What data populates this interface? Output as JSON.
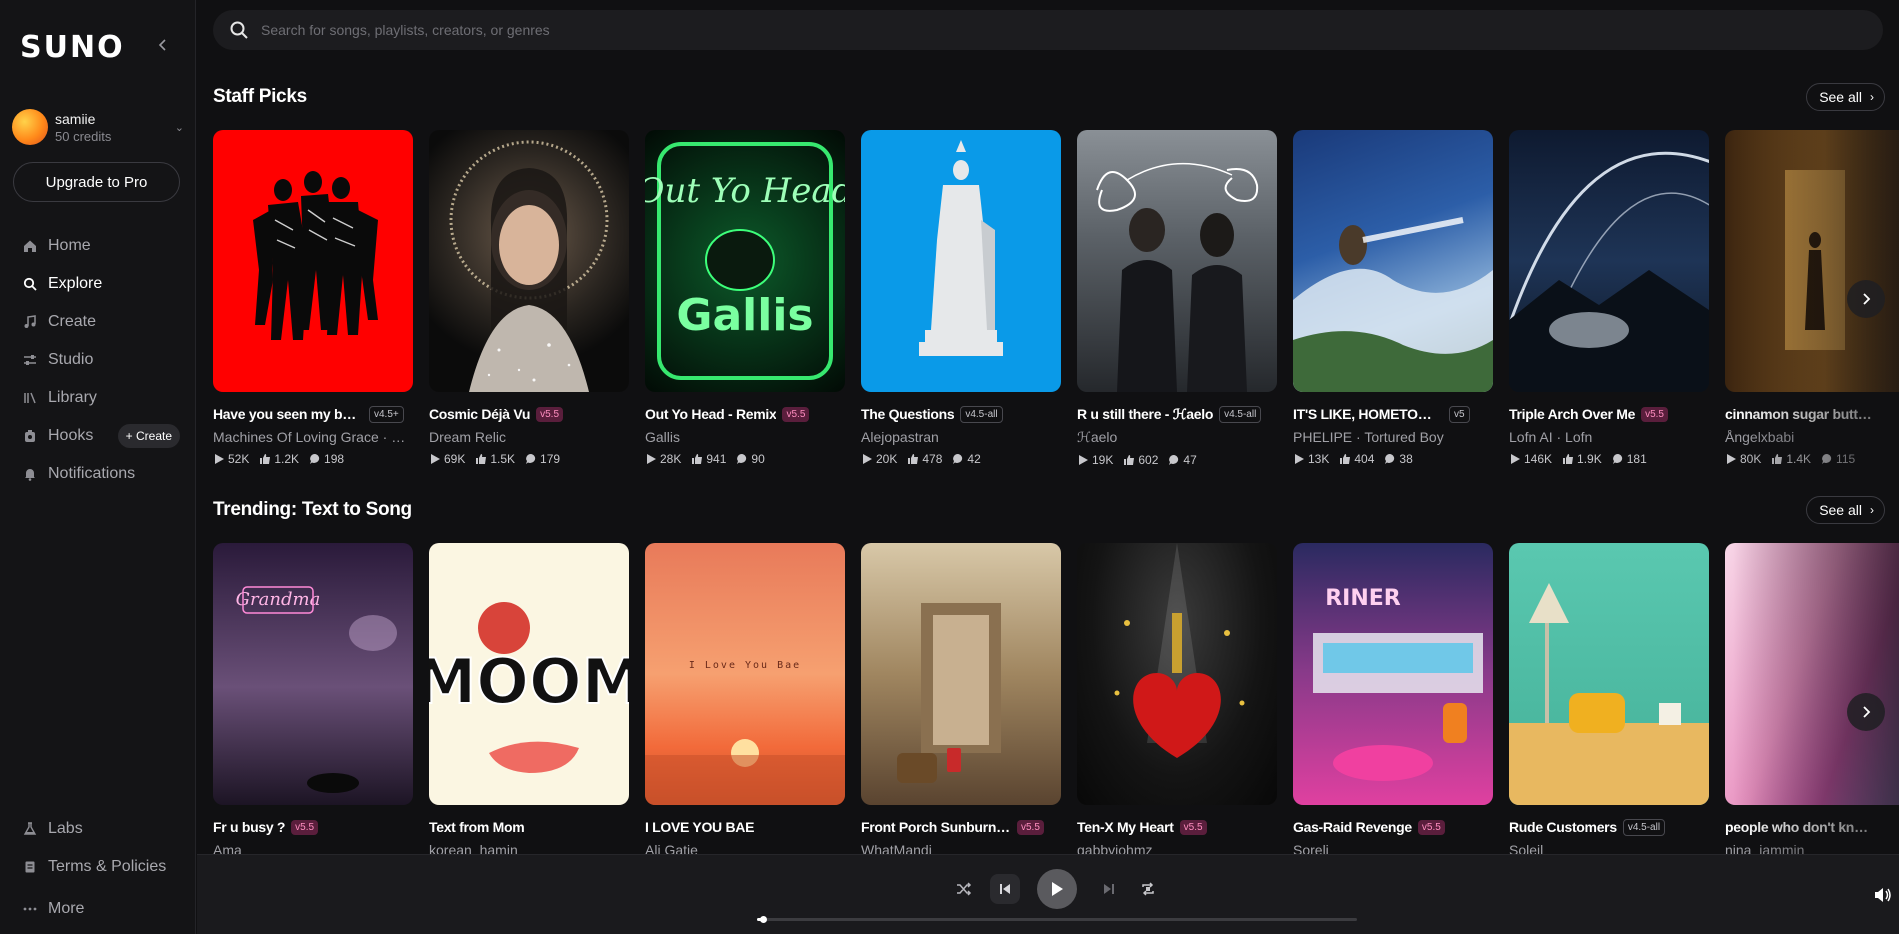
{
  "brand": "SUNO",
  "user": {
    "name": "samiie",
    "credits": "50 credits"
  },
  "upgrade_label": "Upgrade to Pro",
  "nav": [
    {
      "label": "Home",
      "icon": "home-icon"
    },
    {
      "label": "Explore",
      "icon": "search-icon",
      "active": true
    },
    {
      "label": "Create",
      "icon": "music-note-icon"
    },
    {
      "label": "Studio",
      "icon": "sliders-icon"
    },
    {
      "label": "Library",
      "icon": "library-icon"
    },
    {
      "label": "Hooks",
      "icon": "hooks-icon"
    },
    {
      "label": "Notifications",
      "icon": "bell-icon"
    }
  ],
  "hooks_create_label": "+ Create",
  "bottom_nav": [
    {
      "label": "Labs",
      "icon": "flask-icon"
    },
    {
      "label": "Terms & Policies",
      "icon": "document-icon"
    },
    {
      "label": "More",
      "icon": "more-icon"
    }
  ],
  "search": {
    "placeholder": "Search for songs, playlists, creators, or genres"
  },
  "see_all_label": "See all",
  "sections": [
    {
      "title": "Staff Picks",
      "cards": [
        {
          "title": "Have you seen my baby",
          "badge": "v4.5+",
          "badge_style": "grey",
          "artist": "Machines Of Loving Grace · Ha...",
          "plays": "52K",
          "likes": "1.2K",
          "comments": "198"
        },
        {
          "title": "Cosmic Déjà Vu",
          "badge": "v5.5",
          "badge_style": "pink",
          "artist": "Dream Relic",
          "plays": "69K",
          "likes": "1.5K",
          "comments": "179"
        },
        {
          "title": "Out Yo Head - Remix",
          "badge": "v5.5",
          "badge_style": "pink",
          "artist": "Gallis",
          "plays": "28K",
          "likes": "941",
          "comments": "90"
        },
        {
          "title": "The Questions",
          "badge": "v4.5-all",
          "badge_style": "grey",
          "artist": "Alejopastran",
          "plays": "20K",
          "likes": "478",
          "comments": "42"
        },
        {
          "title": "R u still there - ℋaelo",
          "badge": "v4.5-all",
          "badge_style": "grey",
          "artist": "ℋaelo",
          "plays": "19K",
          "likes": "602",
          "comments": "47"
        },
        {
          "title": "IT'S LIKE, HOMETOWN...",
          "badge": "v5",
          "badge_style": "grey",
          "artist": "PHELIPE · Tortured Boy",
          "plays": "13K",
          "likes": "404",
          "comments": "38"
        },
        {
          "title": "Triple Arch Over Me",
          "badge": "v5.5",
          "badge_style": "pink",
          "artist": "Lofn AI · Lofn",
          "plays": "146K",
          "likes": "1.9K",
          "comments": "181"
        },
        {
          "title": "cinnamon sugar butter ba...",
          "badge": "",
          "badge_style": "none",
          "artist": "Ångelxbabi",
          "plays": "80K",
          "likes": "1.4K",
          "comments": "115"
        }
      ]
    },
    {
      "title": "Trending: Text to Song",
      "cards": [
        {
          "title": "Fr u busy ?",
          "badge": "v5.5",
          "badge_style": "pink",
          "artist": "Ama"
        },
        {
          "title": "Text from Mom",
          "badge": "",
          "badge_style": "none",
          "artist": "korean_hamin"
        },
        {
          "title": "I LOVE YOU BAE",
          "badge": "",
          "badge_style": "none",
          "artist": "Ali Gatie"
        },
        {
          "title": "Front Porch Sunburn coo...",
          "badge": "v5.5",
          "badge_style": "pink",
          "artist": "WhatMandi"
        },
        {
          "title": "Ten-X My Heart",
          "badge": "v5.5",
          "badge_style": "pink",
          "artist": "gabbyiohmz"
        },
        {
          "title": "Gas-Raid Revenge",
          "badge": "v5.5",
          "badge_style": "pink",
          "artist": "Soreli"
        },
        {
          "title": "Rude Customers",
          "badge": "v4.5-all",
          "badge_style": "grey",
          "artist": "Soleil"
        },
        {
          "title": "people who don't know ho...",
          "badge": "",
          "badge_style": "none",
          "artist": "nina_jammin"
        }
      ]
    }
  ],
  "art_text": {
    "out_yo_head_top": "Out Yo Head",
    "out_yo_head_bottom": "Gallis",
    "grandma_sign": "Grandma",
    "moom": "MOOM",
    "love_you_bae": "I Love You Bae",
    "riner": "RINER"
  },
  "player": {
    "progress": 0.01
  },
  "colors": {
    "background": "#101012",
    "sidebar": "#141416",
    "badge_pink": "#ff8ec0",
    "accent_red": "#ff0000"
  }
}
